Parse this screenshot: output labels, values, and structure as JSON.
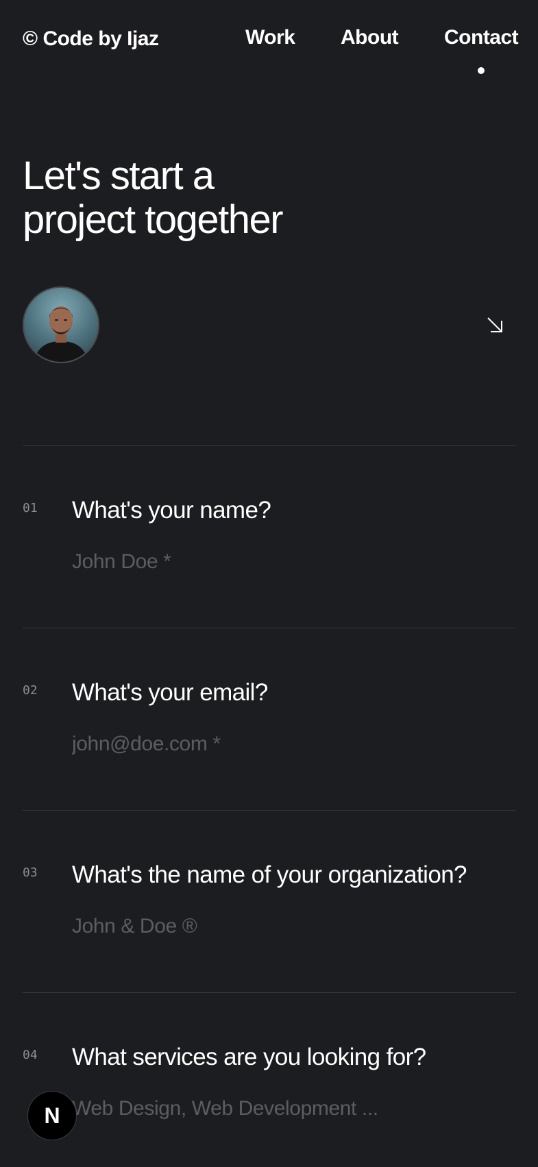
{
  "nav": {
    "logo": "© Code by Ijaz",
    "links": [
      {
        "label": "Work"
      },
      {
        "label": "About"
      },
      {
        "label": "Contact",
        "active": true
      }
    ]
  },
  "hero": {
    "title_line1": "Let's start a",
    "title_line2": "project together",
    "arrow_icon": "arrow-down-right-icon"
  },
  "form": {
    "fields": [
      {
        "number": "01",
        "label": "What's your name?",
        "placeholder": "John Doe *"
      },
      {
        "number": "02",
        "label": "What's your email?",
        "placeholder": "john@doe.com *"
      },
      {
        "number": "03",
        "label": "What's the name of your organization?",
        "placeholder": "John & Doe ®"
      },
      {
        "number": "04",
        "label": "What services are you looking for?",
        "placeholder": "Web Design, Web Development ..."
      }
    ]
  },
  "fab": {
    "letter": "N"
  },
  "colors": {
    "background": "#1c1d20",
    "text": "#ffffff",
    "muted": "#5b5d61",
    "divider": "#34363b"
  }
}
